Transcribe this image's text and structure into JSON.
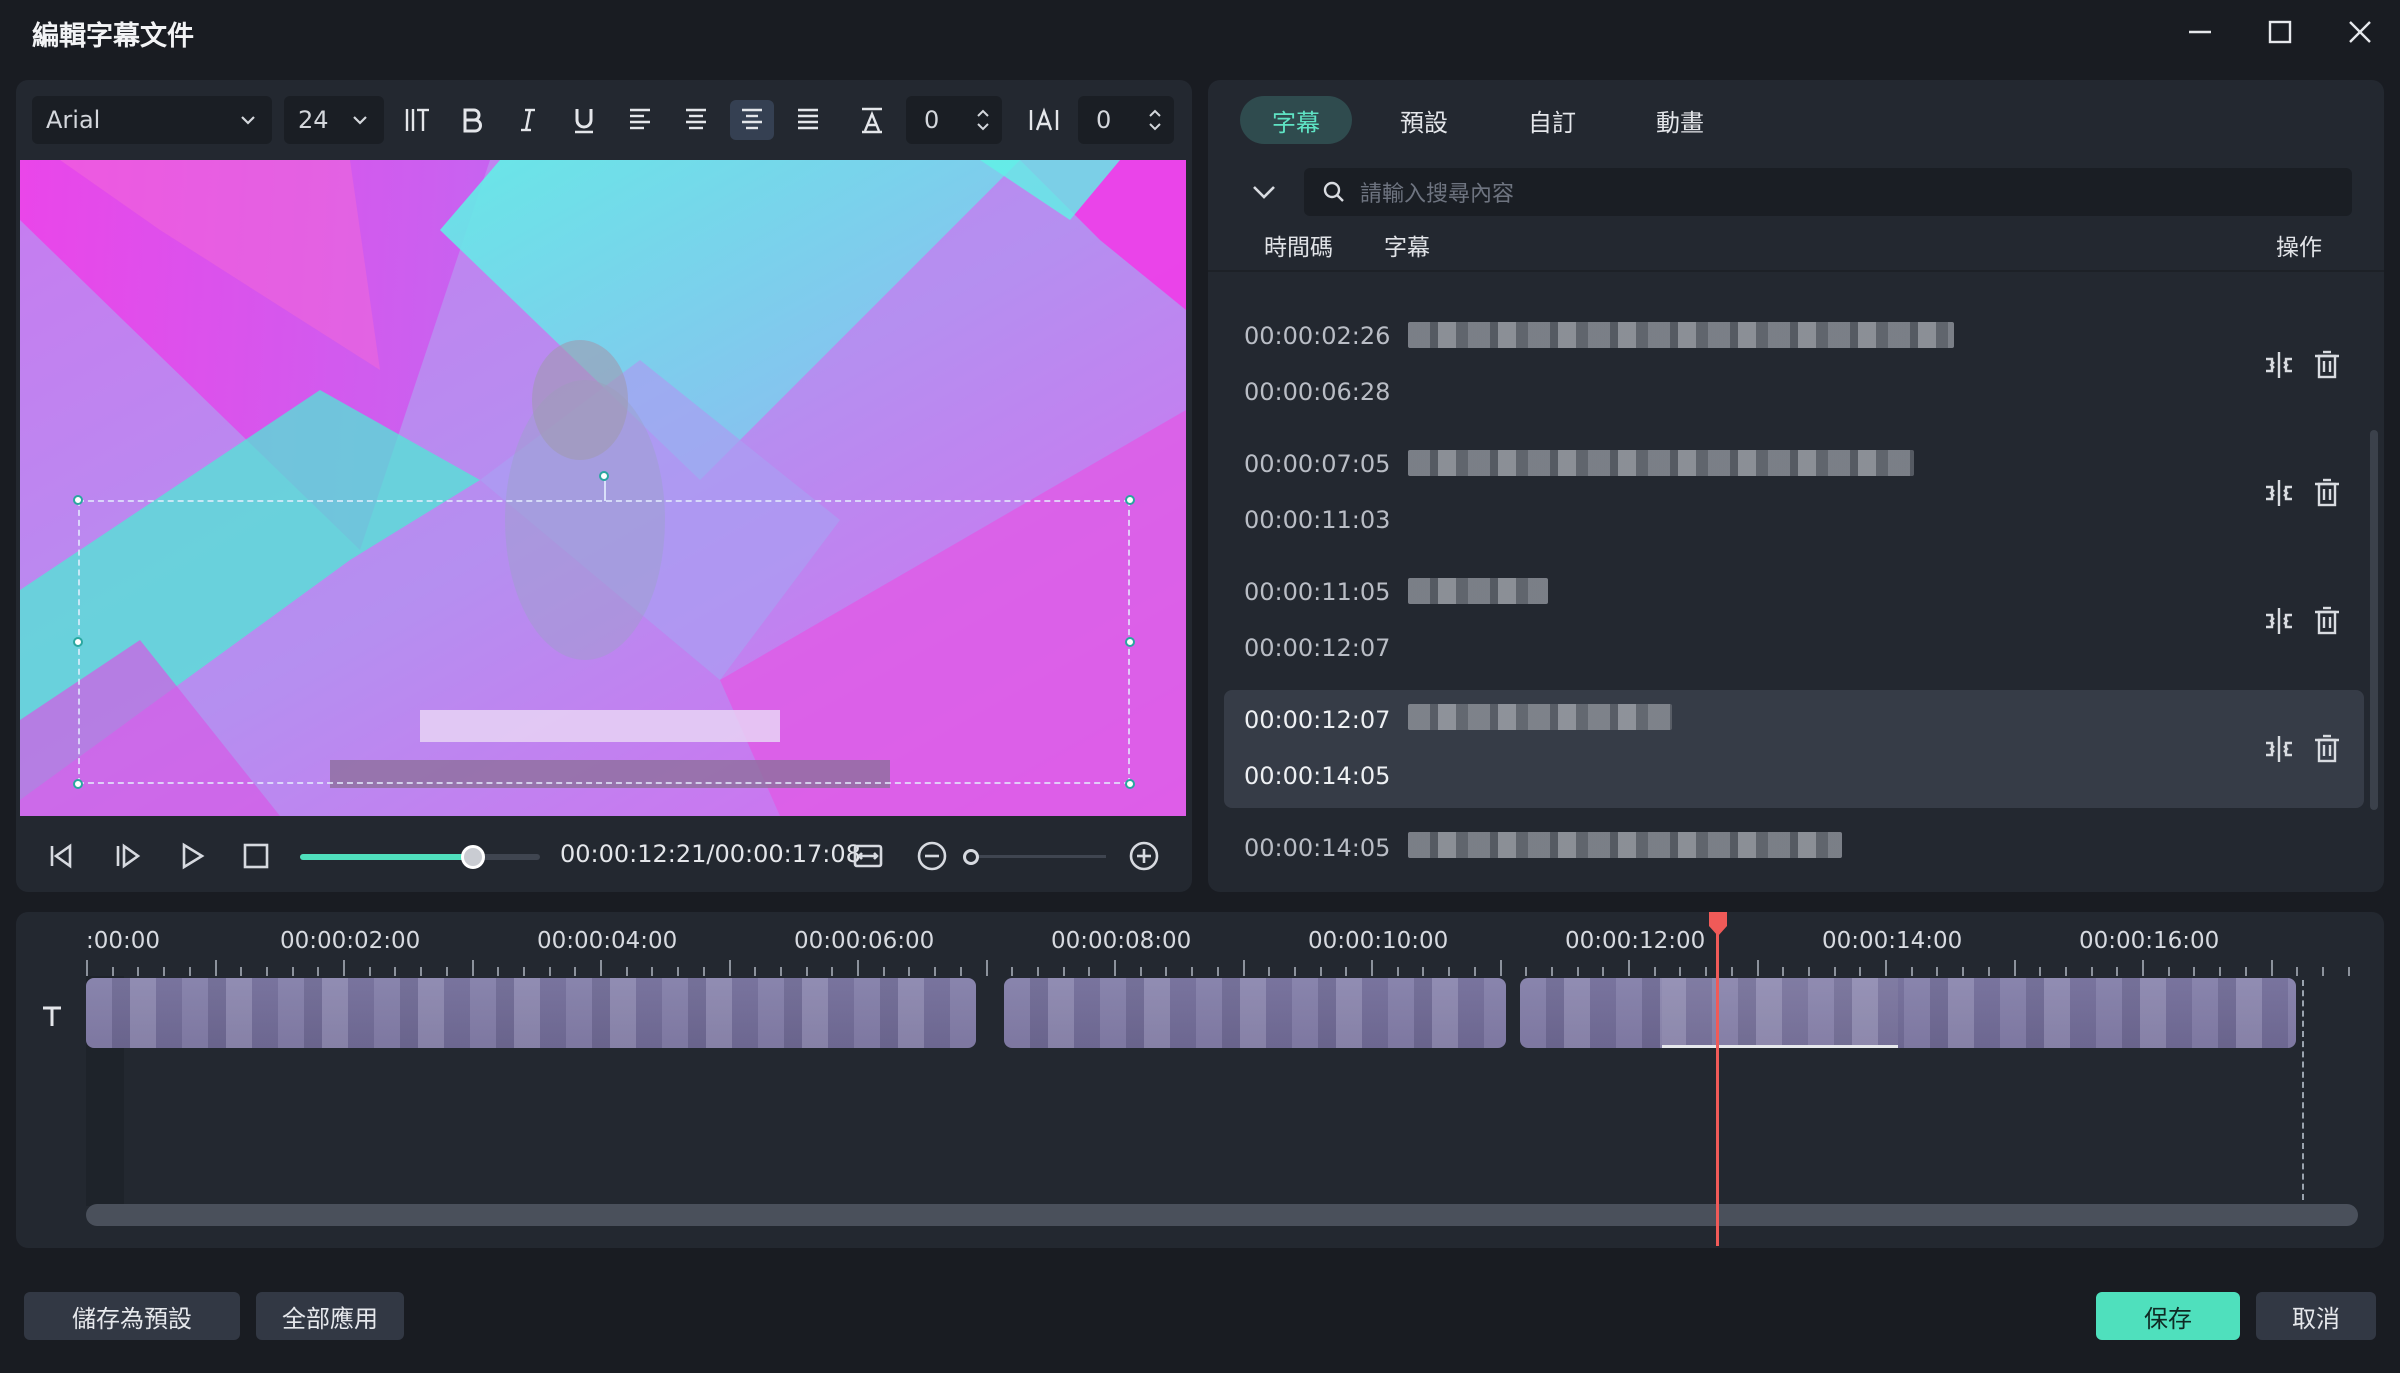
{
  "window": {
    "title": "編輯字幕文件"
  },
  "toolbar": {
    "font": "Arial",
    "size": "24",
    "line_spacing": "0",
    "char_spacing": "0",
    "icons": [
      "vertical-text-icon",
      "bold-icon",
      "italic-icon",
      "underline-icon",
      "align-left-icon",
      "align-center-icon",
      "align-center-active-icon",
      "justify-icon",
      "line-spacing-icon",
      "char-spacing-icon"
    ]
  },
  "player": {
    "time": "00:00:12:21/00:00:17:08",
    "progress": 0.72
  },
  "tabs": [
    "字幕",
    "預設",
    "自訂",
    "動畫"
  ],
  "search": {
    "placeholder": "請輸入搜尋內容"
  },
  "columns": {
    "timecode": "時間碼",
    "subtitle": "字幕",
    "actions": "操作"
  },
  "subtitles": [
    {
      "start": "00:00:02:26",
      "end": "00:00:06:28"
    },
    {
      "start": "00:00:07:05",
      "end": "00:00:11:03"
    },
    {
      "start": "00:00:11:05",
      "end": "00:00:12:07"
    },
    {
      "start": "00:00:12:07",
      "end": "00:00:14:05",
      "selected": true
    },
    {
      "start": "00:00:14:05",
      "end": ""
    }
  ],
  "timeline": {
    "labels": [
      ":00:00",
      "00:00:02:00",
      "00:00:04:00",
      "00:00:06:00",
      "00:00:08:00",
      "00:00:10:00",
      "00:00:12:00",
      "00:00:14:00",
      "00:00:16:00"
    ],
    "track_icon": "text-track-icon"
  },
  "buttons": {
    "save_preset": "儲存為預設",
    "apply_all": "全部應用",
    "save": "保存",
    "cancel": "取消"
  },
  "colors": {
    "accent": "#4fe0bd",
    "playhead": "#f05a58"
  }
}
